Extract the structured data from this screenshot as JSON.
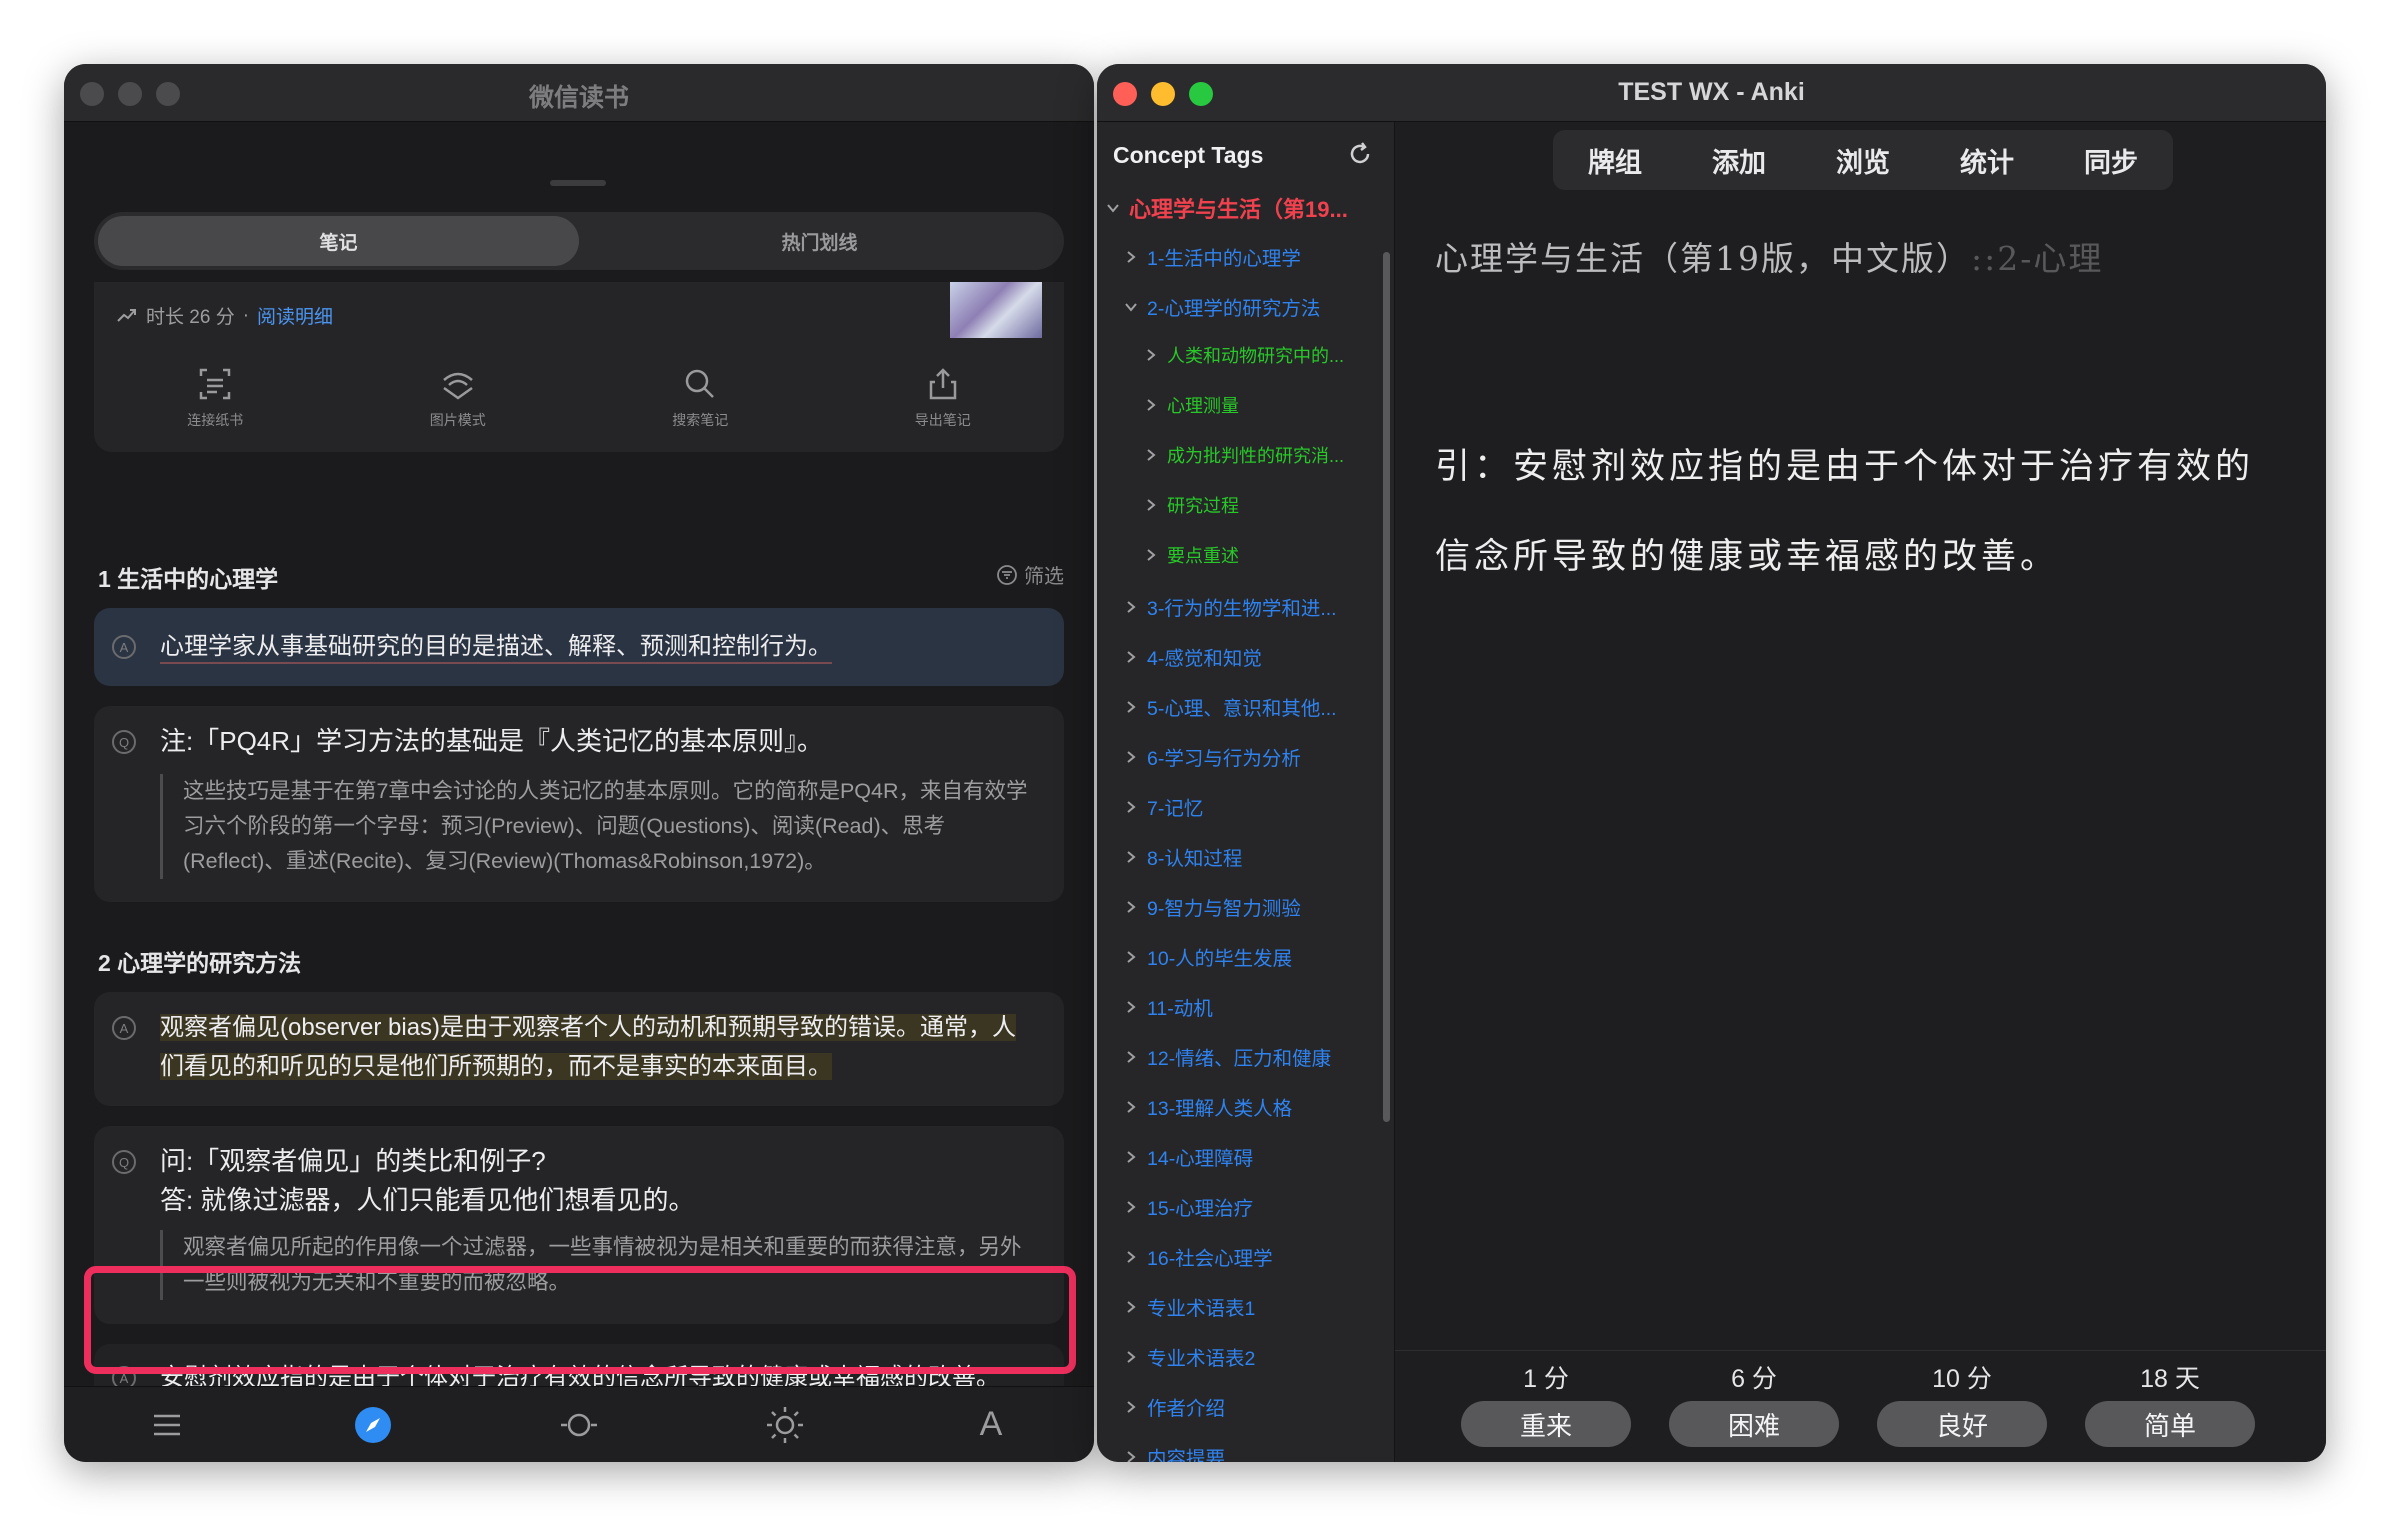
{
  "weread": {
    "window_title": "微信读书",
    "tabs": [
      {
        "label": "笔记",
        "active": true
      },
      {
        "label": "热门划线",
        "active": false
      }
    ],
    "stats": {
      "duration": "时长 26 分",
      "separator": "·",
      "detail_link": "阅读明细"
    },
    "tools": [
      {
        "label": "连接纸书",
        "icon": "scan-icon"
      },
      {
        "label": "图片模式",
        "icon": "image-mode-icon"
      },
      {
        "label": "搜索笔记",
        "icon": "search-icon"
      },
      {
        "label": "导出笔记",
        "icon": "share-icon"
      }
    ],
    "filter_label": "筛选",
    "sections": [
      {
        "title": "1 生活中的心理学"
      },
      {
        "title": "2 心理学的研究方法"
      }
    ],
    "notes": [
      {
        "badge": "A",
        "text": "心理学家从事基础研究的目的是描述、解释、预测和控制行为。"
      },
      {
        "badge": "Q",
        "text": "注:「PQ4R」学习方法的基础是『人类记忆的基本原则』。",
        "quote": "这些技巧是基于在第7章中会讨论的人类记忆的基本原则。它的简称是PQ4R，来自有效学习六个阶段的第一个字母：预习(Preview)、问题(Questions)、阅读(Read)、思考(Reflect)、重述(Recite)、复习(Review)(Thomas&Robinson,1972)。"
      },
      {
        "badge": "A",
        "text": "观察者偏见(observer bias)是由于观察者个人的动机和预期导致的错误。通常，人们看见的和听见的只是他们所预期的，而不是事实的本来面目。"
      },
      {
        "badge": "Q",
        "text_line1": "问:「观察者偏见」的类比和例子?",
        "text_line2": "答: 就像过滤器，人们只能看见他们想看见的。",
        "quote": "观察者偏见所起的作用像一个过滤器，一些事情被视为是相关和重要的而获得注意，另外一些则被视为无关和不重要的而被忽略。"
      },
      {
        "badge": "A",
        "text": "安慰剂效应指的是由于个体对于治疗有效的信念所导致的健康或幸福感的改善。"
      }
    ],
    "bottom_icons": [
      "menu-icon",
      "compass-icon",
      "progress-icon",
      "brightness-icon",
      "font-icon"
    ],
    "bottom_font_glyph": "A"
  },
  "anki": {
    "window_title": "TEST WX - Anki",
    "sidebar_title": "Concept Tags",
    "tree": [
      {
        "label": "心理学与生活（第19...",
        "level": 0,
        "expanded": true,
        "color": "red"
      },
      {
        "label": "1-生活中的心理学",
        "level": 1,
        "expanded": false,
        "color": "blue"
      },
      {
        "label": "2-心理学的研究方法",
        "level": 1,
        "expanded": true,
        "color": "blue"
      },
      {
        "label": "人类和动物研究中的...",
        "level": 2,
        "expanded": false,
        "color": "green"
      },
      {
        "label": "心理测量",
        "level": 2,
        "expanded": false,
        "color": "green"
      },
      {
        "label": "成为批判性的研究消...",
        "level": 2,
        "expanded": false,
        "color": "green"
      },
      {
        "label": "研究过程",
        "level": 2,
        "expanded": false,
        "color": "green"
      },
      {
        "label": "要点重述",
        "level": 2,
        "expanded": false,
        "color": "green"
      },
      {
        "label": "3-行为的生物学和进...",
        "level": 1,
        "expanded": false,
        "color": "blue"
      },
      {
        "label": "4-感觉和知觉",
        "level": 1,
        "expanded": false,
        "color": "blue"
      },
      {
        "label": "5-心理、意识和其他...",
        "level": 1,
        "expanded": false,
        "color": "blue"
      },
      {
        "label": "6-学习与行为分析",
        "level": 1,
        "expanded": false,
        "color": "blue"
      },
      {
        "label": "7-记忆",
        "level": 1,
        "expanded": false,
        "color": "blue"
      },
      {
        "label": "8-认知过程",
        "level": 1,
        "expanded": false,
        "color": "blue"
      },
      {
        "label": "9-智力与智力测验",
        "level": 1,
        "expanded": false,
        "color": "blue"
      },
      {
        "label": "10-人的毕生发展",
        "level": 1,
        "expanded": false,
        "color": "blue"
      },
      {
        "label": "11-动机",
        "level": 1,
        "expanded": false,
        "color": "blue"
      },
      {
        "label": "12-情绪、压力和健康",
        "level": 1,
        "expanded": false,
        "color": "blue"
      },
      {
        "label": "13-理解人类人格",
        "level": 1,
        "expanded": false,
        "color": "blue"
      },
      {
        "label": "14-心理障碍",
        "level": 1,
        "expanded": false,
        "color": "blue"
      },
      {
        "label": "15-心理治疗",
        "level": 1,
        "expanded": false,
        "color": "blue"
      },
      {
        "label": "16-社会心理学",
        "level": 1,
        "expanded": false,
        "color": "blue"
      },
      {
        "label": "专业术语表1",
        "level": 1,
        "expanded": false,
        "color": "blue"
      },
      {
        "label": "专业术语表2",
        "level": 1,
        "expanded": false,
        "color": "blue"
      },
      {
        "label": "作者介绍",
        "level": 1,
        "expanded": false,
        "color": "blue"
      },
      {
        "label": "内容提要",
        "level": 1,
        "expanded": false,
        "color": "blue"
      }
    ],
    "toolbar": [
      "牌组",
      "添加",
      "浏览",
      "统计",
      "同步"
    ],
    "card": {
      "deck_path": "心理学与生活（第19版，中文版）",
      "deck_path_fade": "::2-心理",
      "body_line1": "引：安慰剂效应指的是由于个体对于治疗有效的",
      "body_line2": "信念所导致的健康或幸福感的改善。"
    },
    "answers": [
      {
        "time": "1 分",
        "label": "重来"
      },
      {
        "time": "6 分",
        "label": "困难"
      },
      {
        "time": "10 分",
        "label": "良好"
      },
      {
        "time": "18 天",
        "label": "简单"
      }
    ]
  },
  "colors": {
    "highlight_frame": "#ee2f5e",
    "tree_red": "#f0414e",
    "tree_blue": "#2f83f0",
    "tree_green": "#28c828",
    "link_blue": "#4b95f0"
  }
}
